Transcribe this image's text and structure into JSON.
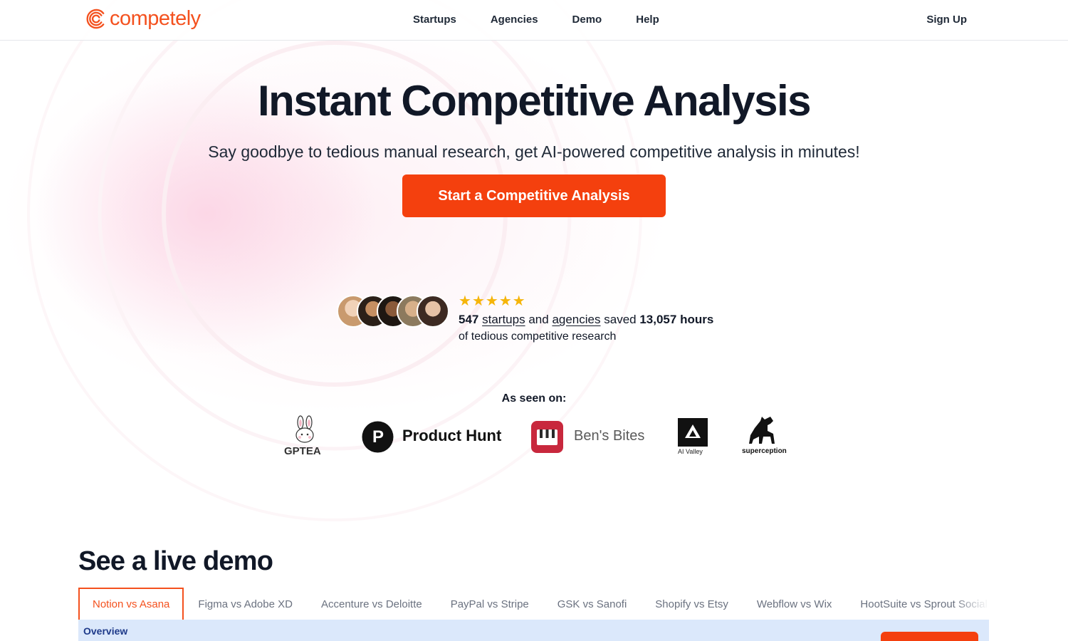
{
  "brand": {
    "name": "competely",
    "accent": "#f4511e",
    "cta_color": "#f4400e"
  },
  "nav": {
    "items": [
      "Startups",
      "Agencies",
      "Demo",
      "Help"
    ],
    "signup": "Sign Up"
  },
  "hero": {
    "title": "Instant Competitive Analysis",
    "subtitle": "Say goodbye to tedious manual research, get AI-powered competitive analysis in minutes!",
    "cta": "Start a Competitive Analysis"
  },
  "social_proof": {
    "rating_stars": 5,
    "count": "547",
    "startups_link": "startups",
    "and": "and",
    "agencies_link": "agencies",
    "saved": "saved",
    "hours": "13,057 hours",
    "line2": "of tedious competitive research"
  },
  "seen_on": {
    "title": "As seen on:",
    "logos": [
      "GPTEA",
      "Product Hunt",
      "Ben's Bites",
      "AI Valley",
      "superception"
    ]
  },
  "demo": {
    "title": "See a live demo",
    "tabs": [
      "Notion vs Asana",
      "Figma vs Adobe XD",
      "Accenture vs Deloitte",
      "PayPal vs Stripe",
      "GSK vs Sanofi",
      "Shopify vs Etsy",
      "Webflow vs Wix",
      "HootSuite vs Sprout Social"
    ],
    "active_tab": 0,
    "panel_label": "Overview"
  }
}
